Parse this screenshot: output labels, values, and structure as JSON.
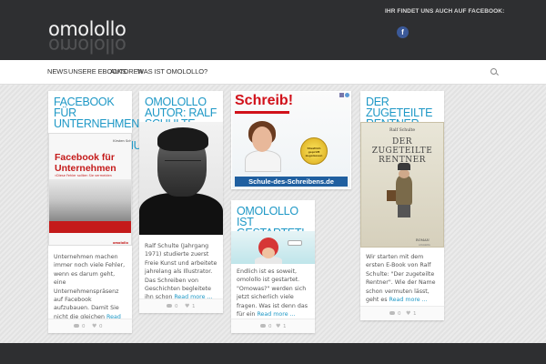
{
  "header": {
    "logo": "omolollo",
    "facebook_note": "IHR FINDET UNS AUCH AUF FACEBOOK:",
    "facebook_icon": "f"
  },
  "nav": {
    "items": [
      "NEWS",
      "UNSERE EBOOKS",
      "AUTOREN",
      "WAS IST OMOLOLLO?"
    ]
  },
  "cards": {
    "fb": {
      "title": "FACEBOOK FÜR UNTERNEHMEN - NEUERSCHEINUNG!",
      "book_author": "Kirsten Schneider Ralf Schulte",
      "book_title": "Facebook für Unternehmen",
      "book_sub": "»Diese Fehler sollten Sie vermeiden",
      "book_pub": "omolollo",
      "text": "Unternehmen machen immer noch viele Fehler, wenn es darum geht, eine Unternehmenspräsenz auf Facebook aufzubauen. Damit Sie nicht die gleichen",
      "read_more": "Read more ...",
      "comments": "0",
      "likes": "0"
    },
    "autor": {
      "title": "OMOLOLLO AUTOR: RALF SCHULTE",
      "text": "Ralf Schulte (Jahrgang 1971) studierte zuerst Freie Kunst und arbeitete jahrelang als Illustrator. Das Schreiben von Geschichten begleitete ihn schon",
      "read_more": "Read more ...",
      "comments": "0",
      "likes": "1"
    },
    "gestartet": {
      "title": "OMOLOLLO IST GESTARTET!",
      "text": "Endlich ist es soweit, omolollo ist gestartet. \"Omowas?\" werden sich jetzt sicherlich viele fragen. Was ist denn das für ein",
      "read_more": "Read more ...",
      "comments": "0",
      "likes": "1"
    },
    "rentner": {
      "title": "DER ZUGETEILTE RENTNER",
      "book_author": "Ralf Schulte",
      "book_title": "DER ZUGETEILTE RENTNER",
      "book_roman": "ROMAN",
      "book_pub": "omolollo",
      "text": "Wir starten mit dem ersten E-Book von Ralf Schulte: \"Der zugeteilte Rentner\". Wie der Name schon vermuten lässt, geht es",
      "read_more": "Read more ...",
      "comments": "0",
      "likes": "1"
    }
  },
  "ad": {
    "title": "Schreib!",
    "badge": "Staatlich geprüft zugelassen",
    "url": "Schule-des-Schreibens.de"
  },
  "colors": {
    "accent": "#1e98c6",
    "header_bg": "#2e2f31",
    "ad_red": "#d1111a"
  }
}
